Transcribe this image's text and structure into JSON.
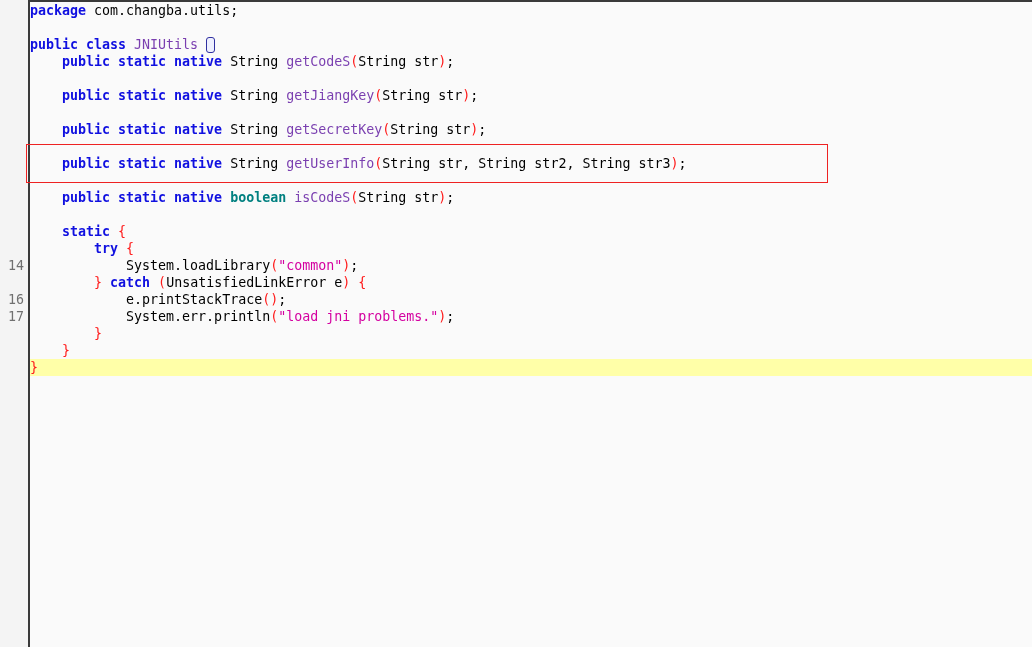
{
  "editor": {
    "lines": [
      {
        "kind": "code",
        "tokens": [
          {
            "kind": "keyword",
            "text": "package"
          },
          {
            "kind": "plain",
            "text": " com.changba.utils;"
          }
        ]
      },
      {
        "kind": "blank"
      },
      {
        "kind": "code",
        "tokens": [
          {
            "kind": "keyword",
            "text": "public class"
          },
          {
            "kind": "name",
            "text": " JNIUtils "
          }
        ],
        "brace_marker": true
      },
      {
        "kind": "code",
        "tokens": [
          {
            "kind": "keyword",
            "text": "    public static native"
          },
          {
            "kind": "plain",
            "text": " String "
          },
          {
            "kind": "name",
            "text": "getCodeS"
          },
          {
            "kind": "paren",
            "text": "("
          },
          {
            "kind": "plain",
            "text": "String str"
          },
          {
            "kind": "paren",
            "text": ")"
          },
          {
            "kind": "plain",
            "text": ";"
          }
        ]
      },
      {
        "kind": "blank"
      },
      {
        "kind": "code",
        "tokens": [
          {
            "kind": "keyword",
            "text": "    public static native"
          },
          {
            "kind": "plain",
            "text": " String "
          },
          {
            "kind": "name",
            "text": "getJiangKey"
          },
          {
            "kind": "paren",
            "text": "("
          },
          {
            "kind": "plain",
            "text": "String str"
          },
          {
            "kind": "paren",
            "text": ")"
          },
          {
            "kind": "plain",
            "text": ";"
          }
        ]
      },
      {
        "kind": "blank"
      },
      {
        "kind": "code",
        "tokens": [
          {
            "kind": "keyword",
            "text": "    public static native"
          },
          {
            "kind": "plain",
            "text": " String "
          },
          {
            "kind": "name",
            "text": "getSecretKey"
          },
          {
            "kind": "paren",
            "text": "("
          },
          {
            "kind": "plain",
            "text": "String str"
          },
          {
            "kind": "paren",
            "text": ")"
          },
          {
            "kind": "plain",
            "text": ";"
          }
        ]
      },
      {
        "kind": "blank"
      },
      {
        "kind": "code",
        "tokens": [
          {
            "kind": "keyword",
            "text": "    public static native"
          },
          {
            "kind": "plain",
            "text": " String "
          },
          {
            "kind": "name",
            "text": "getUserInfo"
          },
          {
            "kind": "paren",
            "text": "("
          },
          {
            "kind": "plain",
            "text": "String str, String str2, String str3"
          },
          {
            "kind": "paren",
            "text": ")"
          },
          {
            "kind": "plain",
            "text": ";"
          }
        ],
        "boxed": true
      },
      {
        "kind": "blank"
      },
      {
        "kind": "code",
        "tokens": [
          {
            "kind": "keyword",
            "text": "    public static native"
          },
          {
            "kind": "primitive",
            "text": " boolean"
          },
          {
            "kind": "name",
            "text": " isCodeS"
          },
          {
            "kind": "paren",
            "text": "("
          },
          {
            "kind": "plain",
            "text": "String str"
          },
          {
            "kind": "paren",
            "text": ")"
          },
          {
            "kind": "plain",
            "text": ";"
          }
        ]
      },
      {
        "kind": "blank"
      },
      {
        "kind": "code",
        "tokens": [
          {
            "kind": "keyword",
            "text": "    static"
          },
          {
            "kind": "paren",
            "text": " {"
          }
        ]
      },
      {
        "kind": "code",
        "tokens": [
          {
            "kind": "keyword",
            "text": "        try"
          },
          {
            "kind": "paren",
            "text": " {"
          }
        ]
      },
      {
        "kind": "code",
        "number": "14",
        "tokens": [
          {
            "kind": "plain",
            "text": "            System.loadLibrary"
          },
          {
            "kind": "paren",
            "text": "("
          },
          {
            "kind": "string",
            "text": "\"common\""
          },
          {
            "kind": "paren",
            "text": ")"
          },
          {
            "kind": "plain",
            "text": ";"
          }
        ]
      },
      {
        "kind": "code",
        "tokens": [
          {
            "kind": "paren",
            "text": "        }"
          },
          {
            "kind": "keyword",
            "text": " catch"
          },
          {
            "kind": "paren",
            "text": " ("
          },
          {
            "kind": "plain",
            "text": "UnsatisfiedLinkError e"
          },
          {
            "kind": "paren",
            "text": ") {"
          }
        ]
      },
      {
        "kind": "code",
        "number": "16",
        "tokens": [
          {
            "kind": "plain",
            "text": "            e.printStackTrace"
          },
          {
            "kind": "paren",
            "text": "()"
          },
          {
            "kind": "plain",
            "text": ";"
          }
        ]
      },
      {
        "kind": "code",
        "number": "17",
        "tokens": [
          {
            "kind": "plain",
            "text": "            System.err.println"
          },
          {
            "kind": "paren",
            "text": "("
          },
          {
            "kind": "string",
            "text": "\"load jni problems.\""
          },
          {
            "kind": "paren",
            "text": ")"
          },
          {
            "kind": "plain",
            "text": ";"
          }
        ]
      },
      {
        "kind": "code",
        "tokens": [
          {
            "kind": "paren",
            "text": "        }"
          }
        ]
      },
      {
        "kind": "code",
        "tokens": [
          {
            "kind": "paren",
            "text": "    }"
          }
        ]
      },
      {
        "kind": "code",
        "tokens": [
          {
            "kind": "paren",
            "text": "}"
          }
        ],
        "current": true
      }
    ]
  }
}
